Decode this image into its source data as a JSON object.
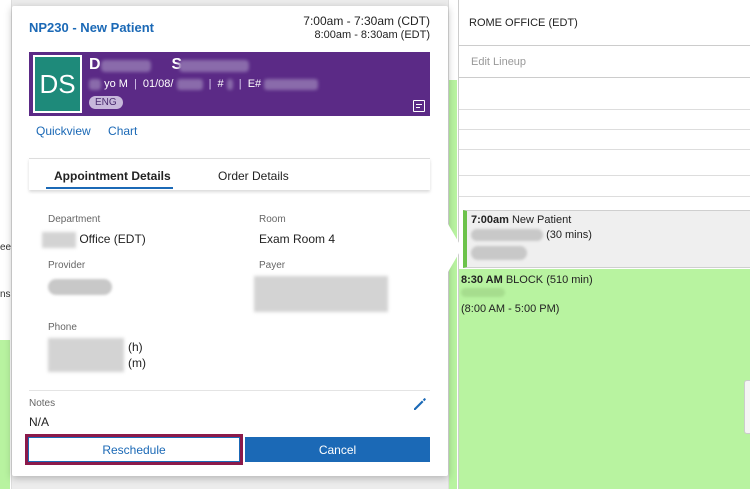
{
  "popup": {
    "title": "NP230 - New Patient",
    "time_primary": "7:00am - 7:30am (CDT)",
    "time_secondary": "8:00am - 8:30am (EDT)",
    "patient": {
      "initials": "DS",
      "first_initial": "D",
      "last_initial": "S",
      "age_sex": "yo M",
      "dob": "01/08/",
      "mrn_prefix": "#",
      "enc_prefix": "E#",
      "language": "ENG"
    },
    "links": [
      "Quickview",
      "Chart"
    ],
    "tabs": [
      "Appointment Details",
      "Order Details"
    ],
    "details": {
      "department_label": "Department",
      "department_value": "Office (EDT)",
      "room_label": "Room",
      "room_value": "Exam Room 4",
      "provider_label": "Provider",
      "payer_label": "Payer",
      "phone_label": "Phone",
      "phone_home": "(h)",
      "phone_mobile": "(m)",
      "notes_label": "Notes",
      "notes_value": "N/A"
    },
    "buttons": {
      "reschedule": "Reschedule",
      "cancel": "Cancel"
    },
    "colors": {
      "accent": "#1b69b6",
      "banner": "#5b2a86",
      "avatar": "#1e8a7a",
      "highlight": "#8b1a4a"
    }
  },
  "schedule": {
    "column_header": "ROME OFFICE (EDT)",
    "edit_lineup": "Edit Lineup",
    "appointment": {
      "time": "7:00am",
      "type": "New Patient",
      "duration": "(30 mins)"
    },
    "block": {
      "time": "8:30 AM",
      "label": "BLOCK (510 min)",
      "range": "(8:00 AM - 5:00 PM)"
    },
    "left_fragments": [
      "ee",
      "ns"
    ],
    "colors": {
      "block_green": "#b8f3a0"
    }
  }
}
